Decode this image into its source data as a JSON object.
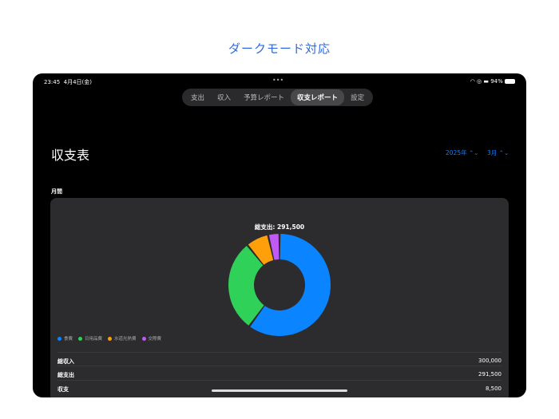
{
  "caption": "ダークモード対応",
  "status": {
    "time": "23:45",
    "date": "4月4日(金)",
    "battery": "94%"
  },
  "tabs": [
    {
      "label": "支出"
    },
    {
      "label": "収入"
    },
    {
      "label": "予算レポート"
    },
    {
      "label": "収支レポート",
      "active": true
    },
    {
      "label": "設定"
    }
  ],
  "page_title": "収支表",
  "year_selector": "2025年 ⌃⌄",
  "month_selector": "3月 ⌃⌄",
  "section_label": "月間",
  "total_label": "総支出: 291,500",
  "chart_data": {
    "type": "pie",
    "title": "総支出: 291,500",
    "categories": [
      "食費",
      "日用品費",
      "水道光熱費",
      "交際費"
    ],
    "values": [
      175000,
      85000,
      21000,
      10500
    ],
    "colors": [
      "#0a84ff",
      "#30d158",
      "#ff9f0a",
      "#bf5af2"
    ],
    "legend": "bottom-left"
  },
  "summary": [
    {
      "label": "総収入",
      "value": "300,000"
    },
    {
      "label": "総支出",
      "value": "291,500"
    },
    {
      "label": "収支",
      "value": "8,500"
    }
  ]
}
